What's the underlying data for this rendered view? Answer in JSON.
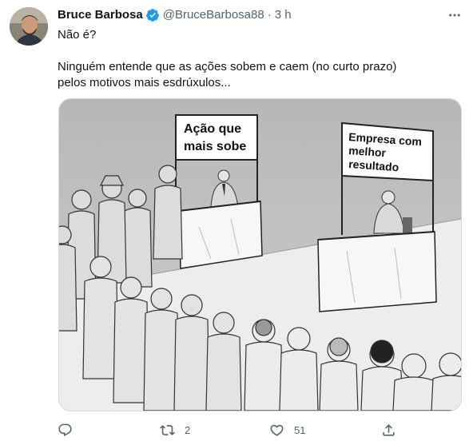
{
  "tweet": {
    "author_name": "Bruce Barbosa",
    "author_handle": "@BruceBarbosa88",
    "separator": "·",
    "time": "3 h",
    "text_line1": "Não é?",
    "text_line2": "Ninguém entende que as ações sobem e caem (no curto prazo) pelos motivos mais esdrúxulos...",
    "image": {
      "left_sign_line1": "Ação que",
      "left_sign_line2": "mais sobe",
      "right_sign_line1": "Empresa com",
      "right_sign_line2": "melhor",
      "right_sign_line3": "resultado"
    },
    "actions": {
      "reply_count": "",
      "retweet_count": "2",
      "like_count": "51"
    },
    "colors": {
      "verified": "#1d9bf0",
      "secondary_text": "#536471",
      "border": "#cfd9de"
    },
    "icons": [
      "verified-badge-icon",
      "more-icon",
      "reply-icon",
      "retweet-icon",
      "like-icon",
      "share-icon"
    ]
  }
}
